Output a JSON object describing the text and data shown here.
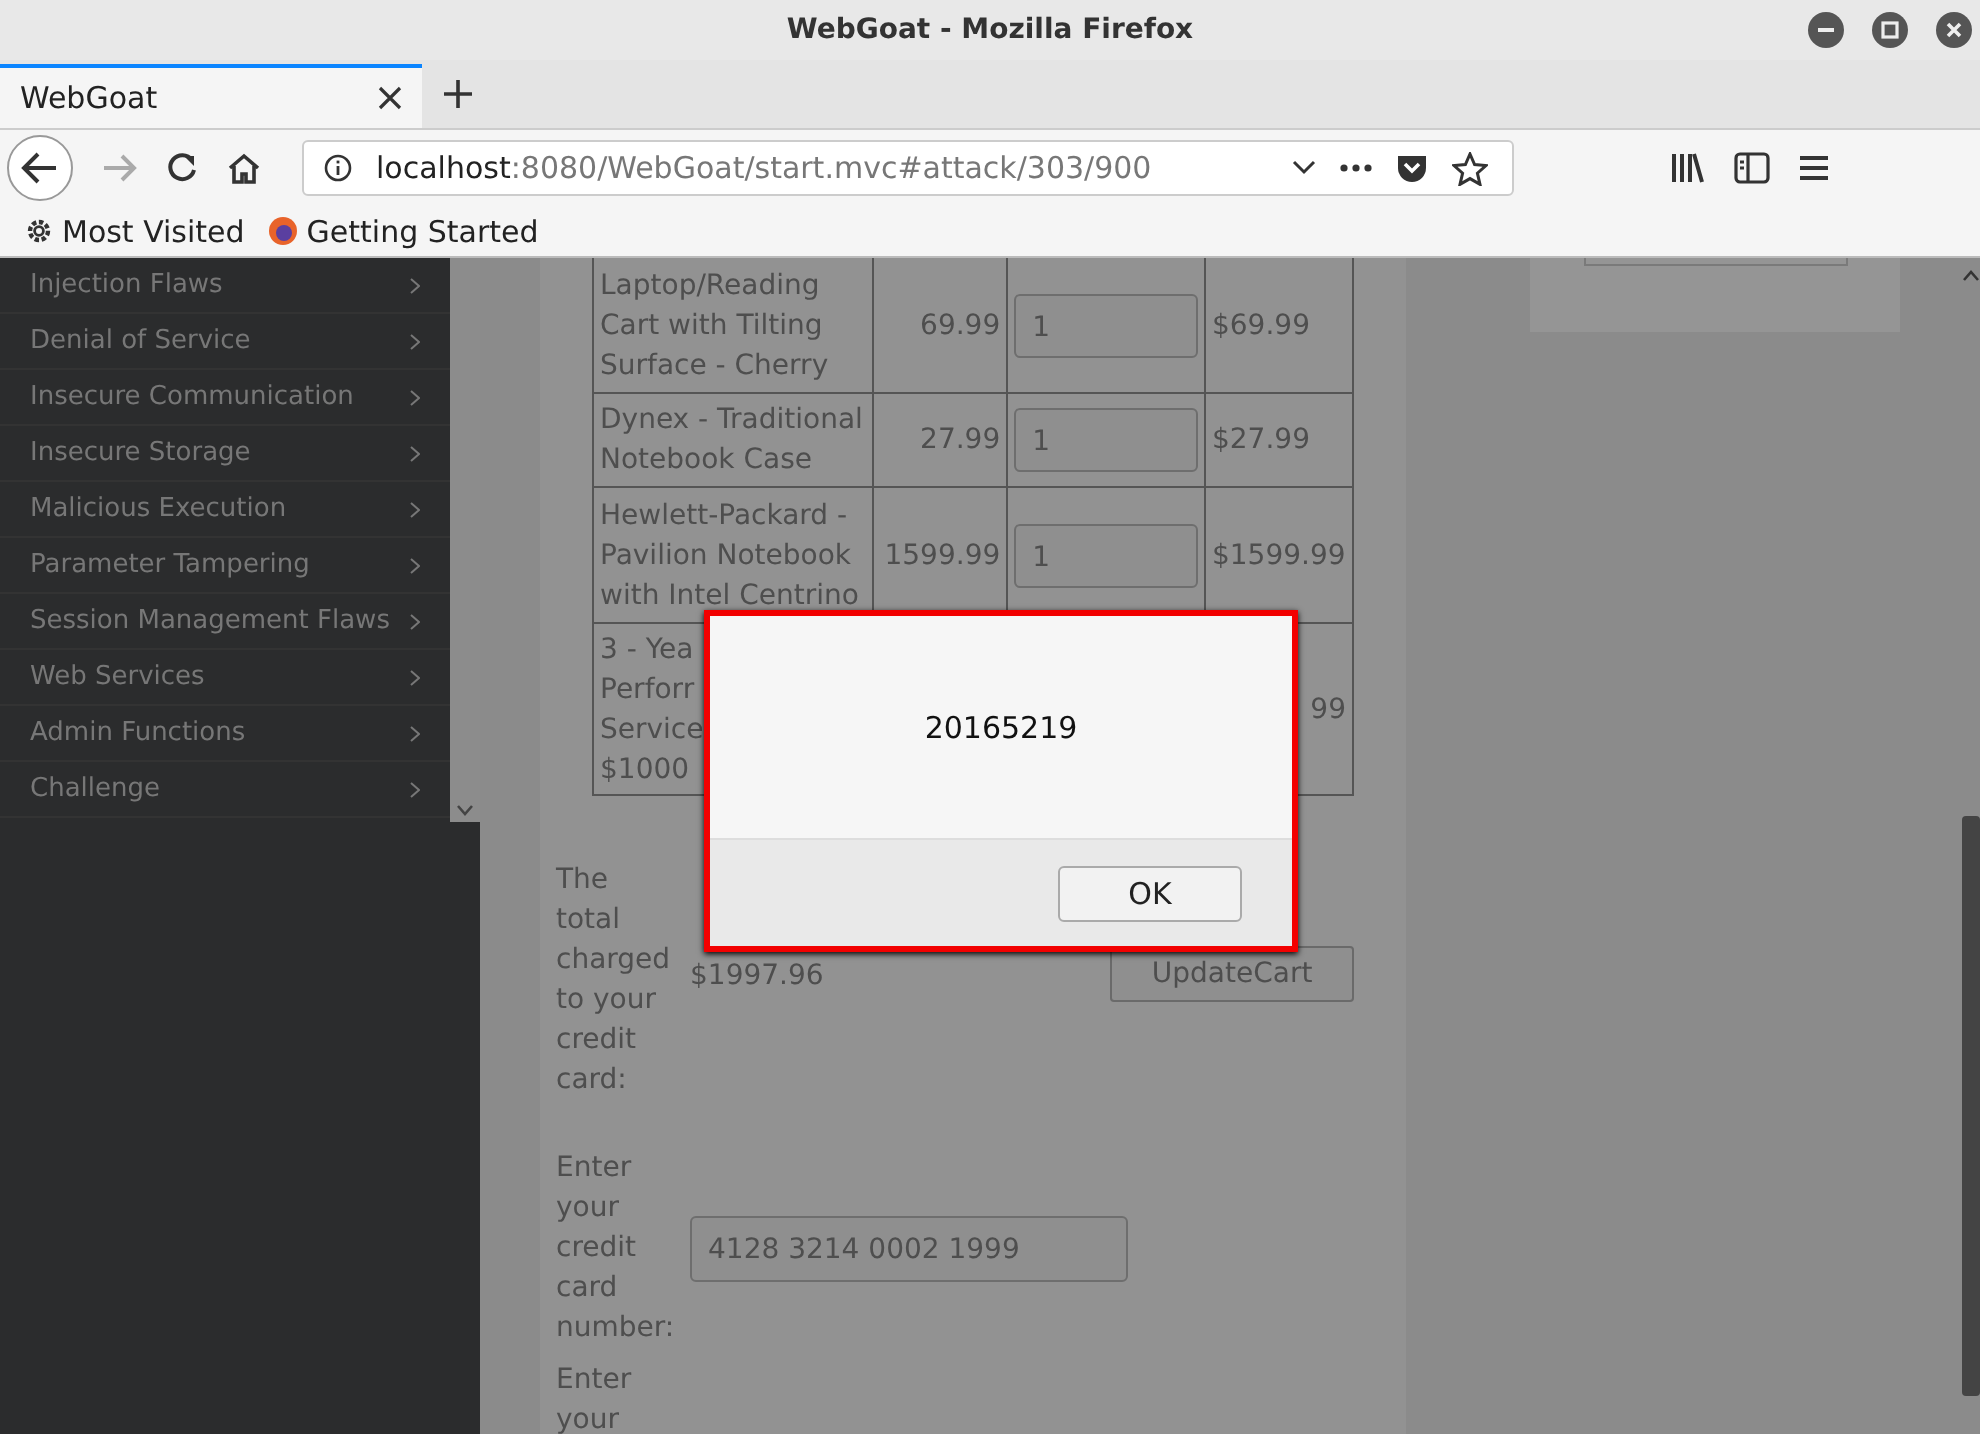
{
  "window": {
    "title": "WebGoat - Mozilla Firefox"
  },
  "tabs": [
    {
      "label": "WebGoat",
      "selected": true
    }
  ],
  "address_bar": {
    "host": "localhost",
    "path": ":8080/WebGoat/start.mvc#attack/303/900"
  },
  "bookmarks": [
    {
      "label": "Most Visited",
      "kind": "gear"
    },
    {
      "label": "Getting Started",
      "kind": "firefox"
    }
  ],
  "sidebar": {
    "items": [
      "Injection Flaws",
      "Denial of Service",
      "Insecure Communication",
      "Insecure Storage",
      "Malicious Execution",
      "Parameter Tampering",
      "Session Management Flaws",
      "Web Services",
      "Admin Functions",
      "Challenge"
    ]
  },
  "cart": {
    "rows": [
      {
        "name": "Laptop/Reading Cart with Tilting Surface - Cherry",
        "price": "69.99",
        "quantity": "1",
        "total": "$69.99"
      },
      {
        "name": "Dynex - Traditional Notebook Case",
        "price": "27.99",
        "quantity": "1",
        "total": "$27.99"
      },
      {
        "name": "Hewlett-Packard - Pavilion Notebook with Intel Centrino",
        "price": "1599.99",
        "quantity": "1",
        "total": "$1599.99"
      },
      {
        "name_lines": [
          "3 - Yea",
          "Perforr",
          "Service",
          "$1000"
        ],
        "total": "99"
      }
    ]
  },
  "checkout": {
    "total_label": "The total charged to your credit card:",
    "total": "$1997.96",
    "update_button": "UpdateCart",
    "card_label": "Enter your credit card number:",
    "card_value": "4128 3214 0002 1999",
    "next_label": "Enter your"
  },
  "dialog": {
    "message": "20165219",
    "button": "OK"
  }
}
